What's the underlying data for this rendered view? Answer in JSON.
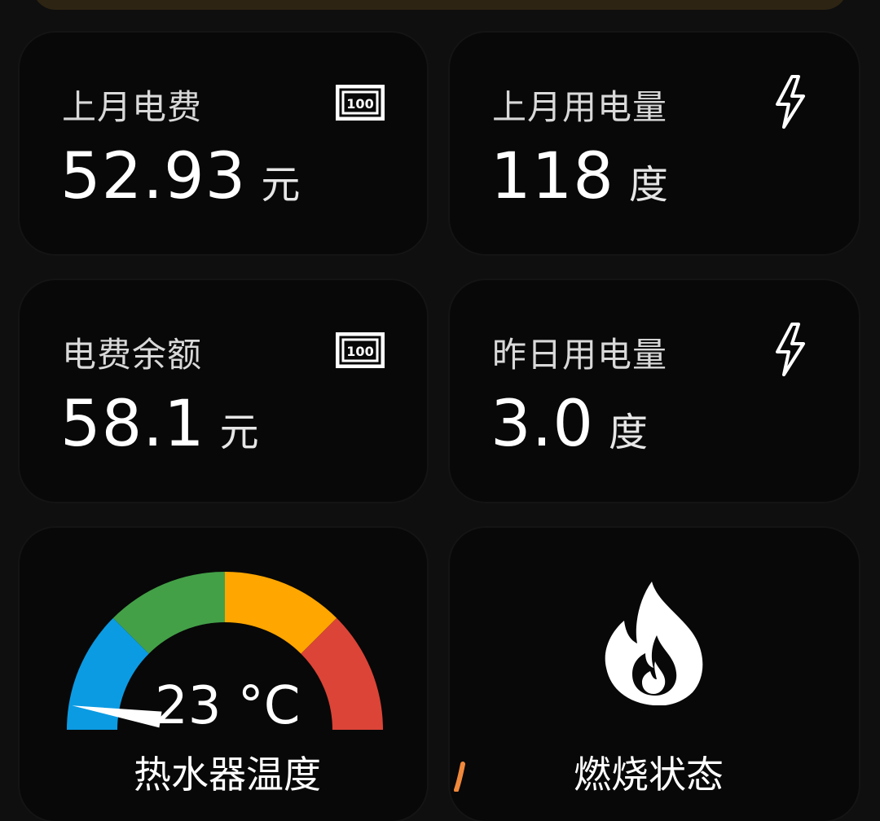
{
  "cards": [
    {
      "title": "上月电费",
      "value": "52.93",
      "unit": "元",
      "icon": "money-icon"
    },
    {
      "title": "上月用电量",
      "value": "118",
      "unit": "度",
      "icon": "lightning-icon"
    },
    {
      "title": "电费余额",
      "value": "58.1",
      "unit": "元",
      "icon": "money-icon"
    },
    {
      "title": "昨日用电量",
      "value": "3.0",
      "unit": "度",
      "icon": "lightning-icon"
    }
  ],
  "money_icon_text": "100",
  "gauge": {
    "display": "23 °C",
    "label": "热水器温度",
    "value": 23,
    "min": 20,
    "max": 80,
    "colors": {
      "blue": "#0b9be3",
      "green": "#43a047",
      "orange": "#ffa600",
      "red": "#db4437"
    }
  },
  "burn": {
    "label": "燃烧状态",
    "icon": "flame-icon"
  },
  "theme": {
    "background": "#0f0f0f",
    "card": "#080808",
    "banner": "#2e2413"
  }
}
